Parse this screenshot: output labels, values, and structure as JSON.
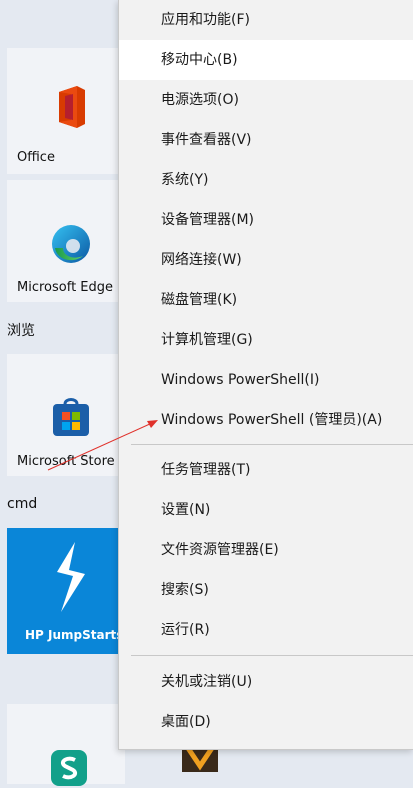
{
  "tiles": {
    "office": {
      "label": "Office"
    },
    "edge": {
      "label": "Microsoft Edge"
    },
    "group_browse": "浏览",
    "store": {
      "label": "Microsoft Store"
    },
    "group_cmd": "cmd",
    "hp": {
      "label": "HP JumpStarts"
    }
  },
  "menu": {
    "items": [
      {
        "label": "应用和功能(F)"
      },
      {
        "label": "移动中心(B)"
      },
      {
        "label": "电源选项(O)"
      },
      {
        "label": "事件查看器(V)"
      },
      {
        "label": "系统(Y)"
      },
      {
        "label": "设备管理器(M)"
      },
      {
        "label": "网络连接(W)"
      },
      {
        "label": "磁盘管理(K)"
      },
      {
        "label": "计算机管理(G)"
      },
      {
        "label": "Windows PowerShell(I)"
      },
      {
        "label": "Windows PowerShell (管理员)(A)"
      },
      {
        "label": "任务管理器(T)"
      },
      {
        "label": "设置(N)"
      },
      {
        "label": "文件资源管理器(E)"
      },
      {
        "label": "搜索(S)"
      },
      {
        "label": "运行(R)"
      },
      {
        "label": "关机或注销(U)"
      },
      {
        "label": "桌面(D)"
      }
    ]
  },
  "colors": {
    "annotation_arrow": "#e0312b",
    "hp_tile": "#0a86d8",
    "menu_bg": "#f2f2f2",
    "menu_hover": "#ffffff"
  }
}
